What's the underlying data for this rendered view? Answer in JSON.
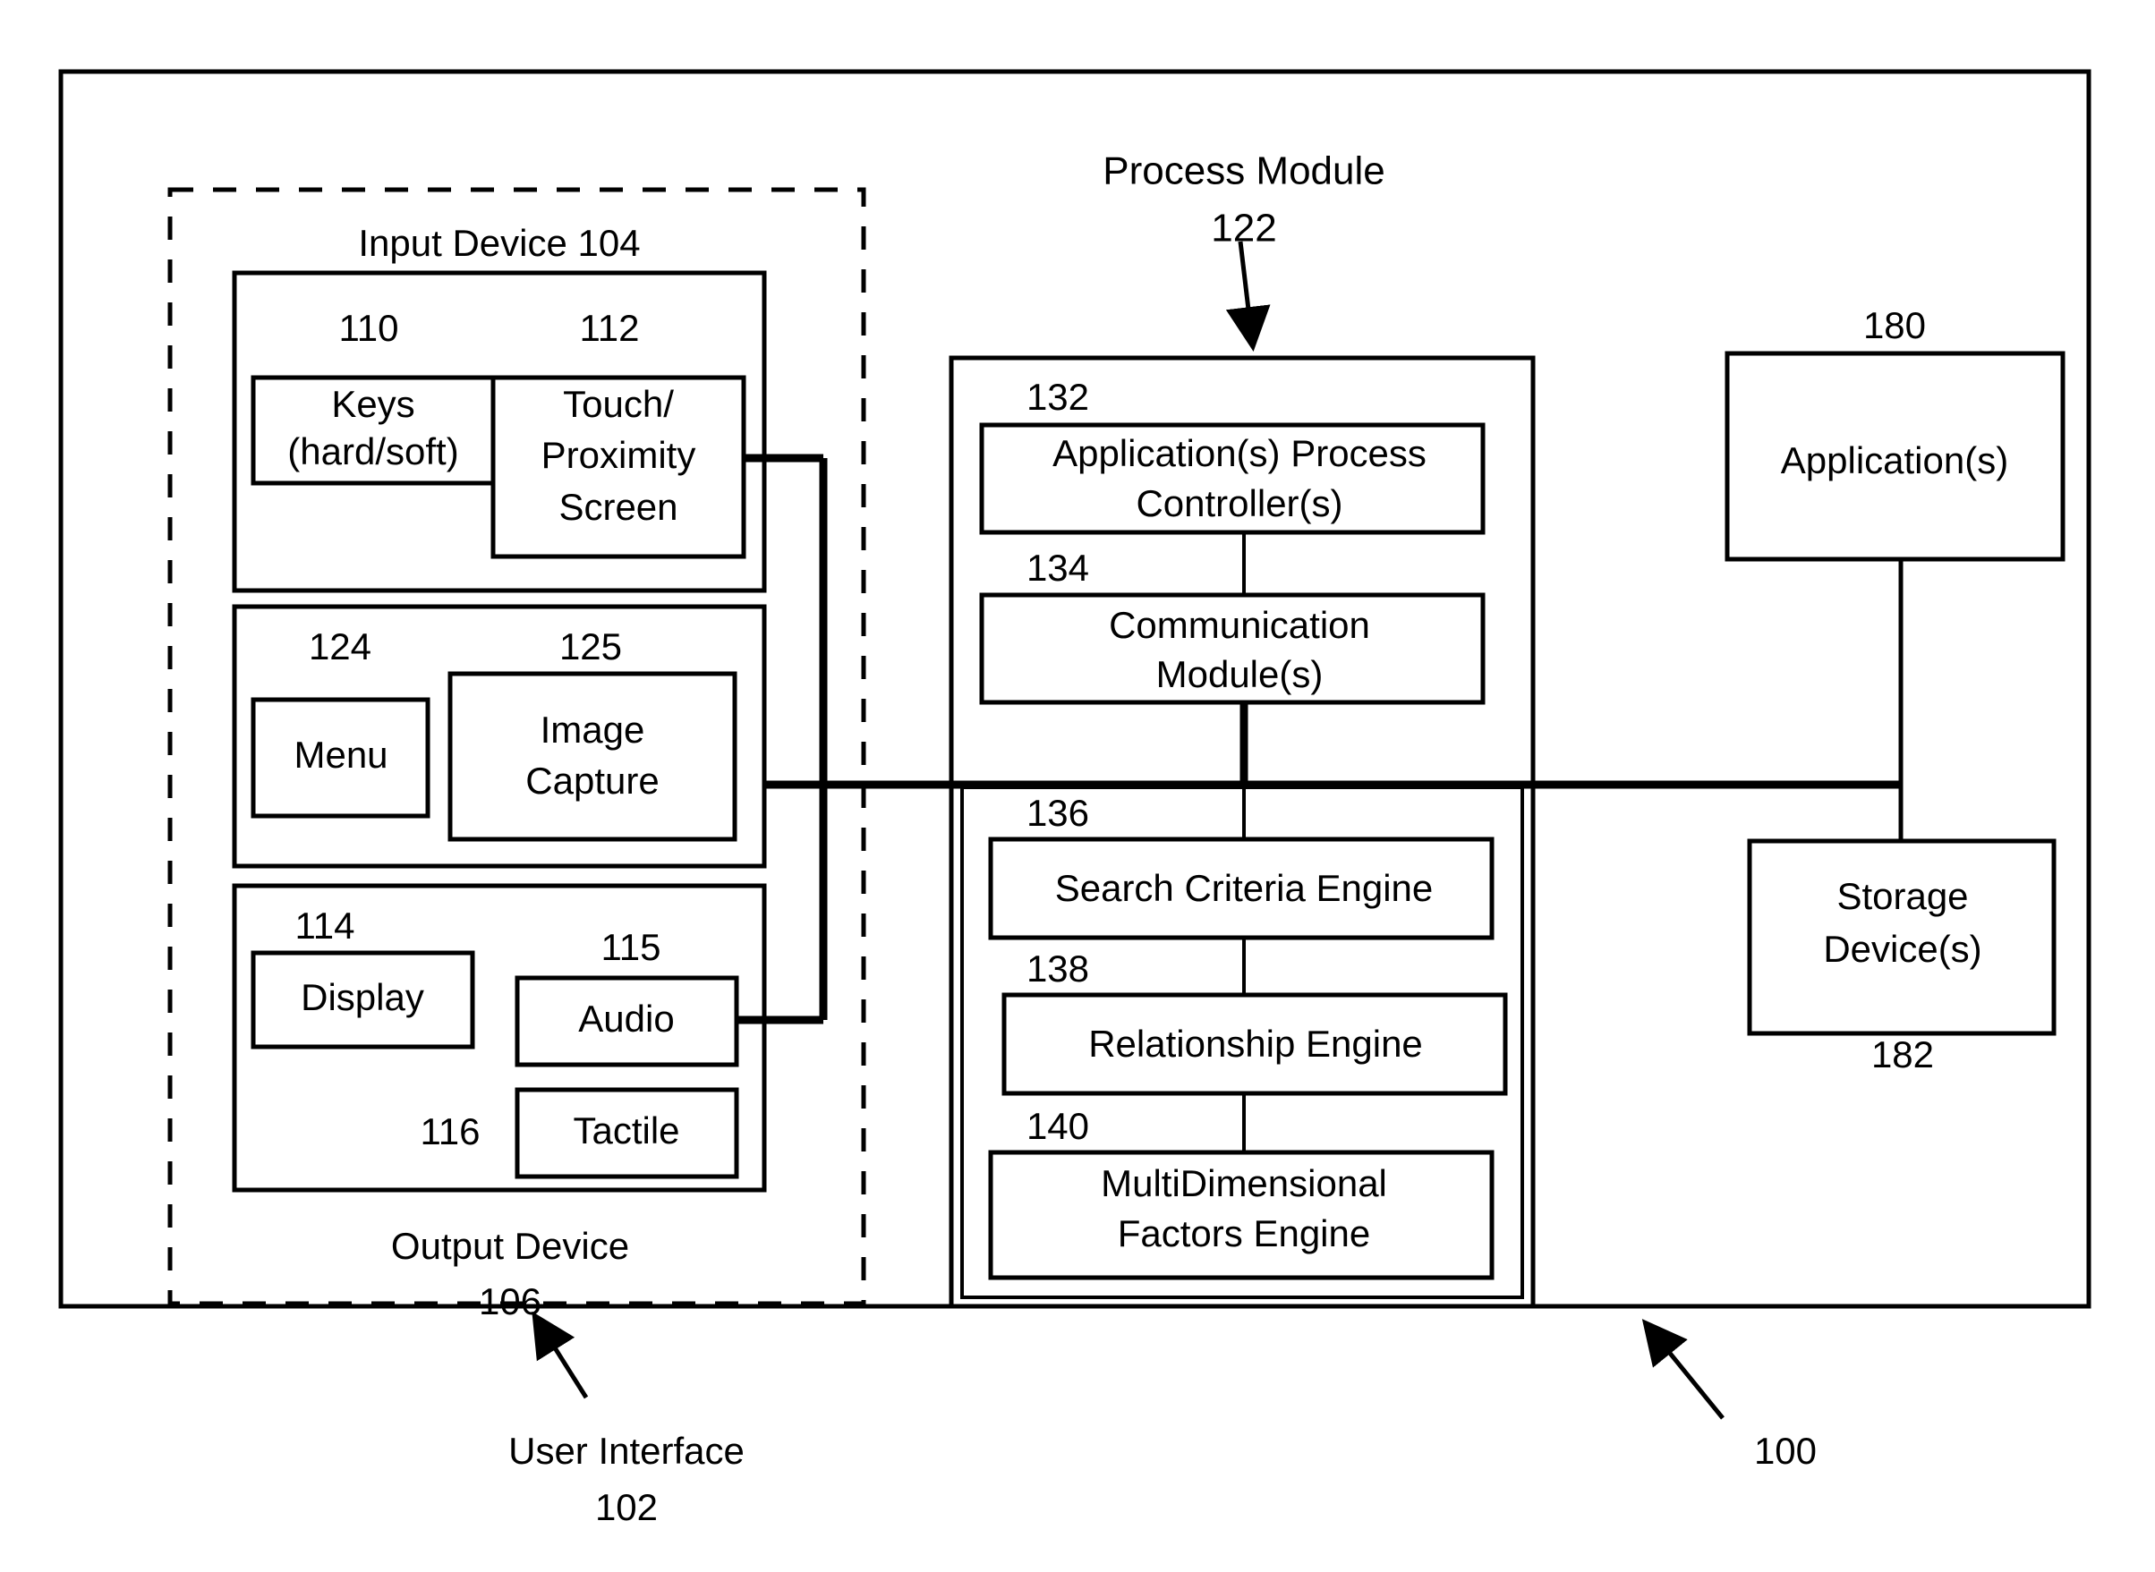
{
  "figure": {
    "outer_ref": "100",
    "user_interface": {
      "label": "User Interface",
      "ref": "102"
    },
    "input_device": {
      "label": "Input Device 104"
    },
    "output_device": {
      "label": "Output Device",
      "ref": "106"
    },
    "process_module": {
      "label": "Process Module",
      "ref": "122"
    }
  },
  "input_group": {
    "items": [
      {
        "ref": "110",
        "label_line1": "Keys",
        "label_line2": "(hard/soft)"
      },
      {
        "ref": "112",
        "label_line1": "Touch/",
        "label_line2": "Proximity",
        "label_line3": "Screen"
      }
    ]
  },
  "capture_group": {
    "items": [
      {
        "ref": "124",
        "label_line1": "Menu"
      },
      {
        "ref": "125",
        "label_line1": "Image",
        "label_line2": "Capture"
      }
    ]
  },
  "output_group": {
    "items": [
      {
        "ref": "114",
        "label_line1": "Display"
      },
      {
        "ref": "115",
        "label_line1": "Audio"
      },
      {
        "ref": "116",
        "label_line1": "Tactile"
      }
    ]
  },
  "process_group": {
    "items": [
      {
        "ref": "132",
        "label_line1": "Application(s) Process",
        "label_line2": "Controller(s)"
      },
      {
        "ref": "134",
        "label_line1": "Communication",
        "label_line2": "Module(s)"
      },
      {
        "ref": "136",
        "label_line1": "Search Criteria Engine"
      },
      {
        "ref": "138",
        "label_line1": "Relationship Engine"
      },
      {
        "ref": "140",
        "label_line1": "MultiDimensional",
        "label_line2": "Factors Engine"
      }
    ]
  },
  "external_group": {
    "items": [
      {
        "ref": "180",
        "label_line1": "Application(s)",
        "ref_position": "above"
      },
      {
        "ref": "182",
        "label_line1": "Storage",
        "label_line2": "Device(s)",
        "ref_position": "below"
      }
    ]
  },
  "colors": {
    "line": "#000000",
    "background": "#ffffff"
  }
}
